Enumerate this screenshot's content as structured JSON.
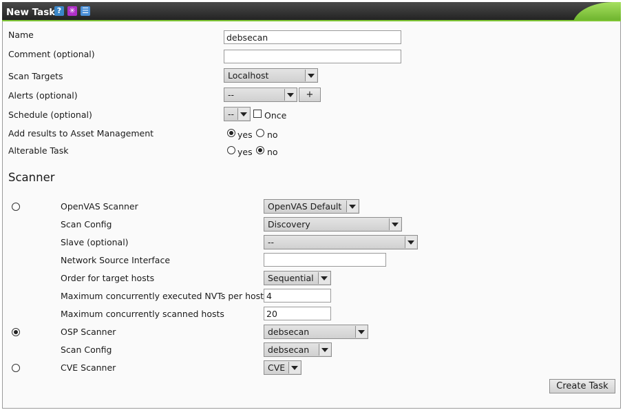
{
  "window": {
    "title": "New Task"
  },
  "title_icons": [
    "help-icon",
    "wizard-icon",
    "list-icon"
  ],
  "form": {
    "name": {
      "label": "Name",
      "value": "debsecan"
    },
    "comment": {
      "label": "Comment (optional)",
      "value": ""
    },
    "scan_targets": {
      "label": "Scan Targets",
      "selected": "Localhost"
    },
    "alerts": {
      "label": "Alerts (optional)",
      "selected": "--",
      "add_label": "+"
    },
    "schedule": {
      "label": "Schedule (optional)",
      "selected": "--",
      "once_label": "Once",
      "once_checked": false
    },
    "asset_mgmt": {
      "label": "Add results to Asset Management",
      "yes_label": "yes",
      "no_label": "no",
      "value": "yes"
    },
    "alterable": {
      "label": "Alterable Task",
      "yes_label": "yes",
      "no_label": "no",
      "value": "no"
    }
  },
  "scanner": {
    "heading": "Scanner",
    "selected": "osp",
    "openvas": {
      "label": "OpenVAS Scanner",
      "selected": "OpenVAS Default",
      "scan_config_label": "Scan Config",
      "scan_config": "Discovery",
      "slave_label": "Slave (optional)",
      "slave": "--",
      "nsi_label": "Network Source Interface",
      "nsi": "",
      "order_label": "Order for target hosts",
      "order": "Sequential",
      "max_nvts_label": "Maximum concurrently executed NVTs per host",
      "max_nvts": "4",
      "max_hosts_label": "Maximum concurrently scanned hosts",
      "max_hosts": "20"
    },
    "osp": {
      "label": "OSP Scanner",
      "selected": "debsecan",
      "scan_config_label": "Scan Config",
      "scan_config": "debsecan"
    },
    "cve": {
      "label": "CVE Scanner",
      "selected": "CVE"
    }
  },
  "actions": {
    "create_label": "Create Task"
  },
  "colors": {
    "accent": "#7ec634",
    "titlebar": "#2b2b2b"
  }
}
